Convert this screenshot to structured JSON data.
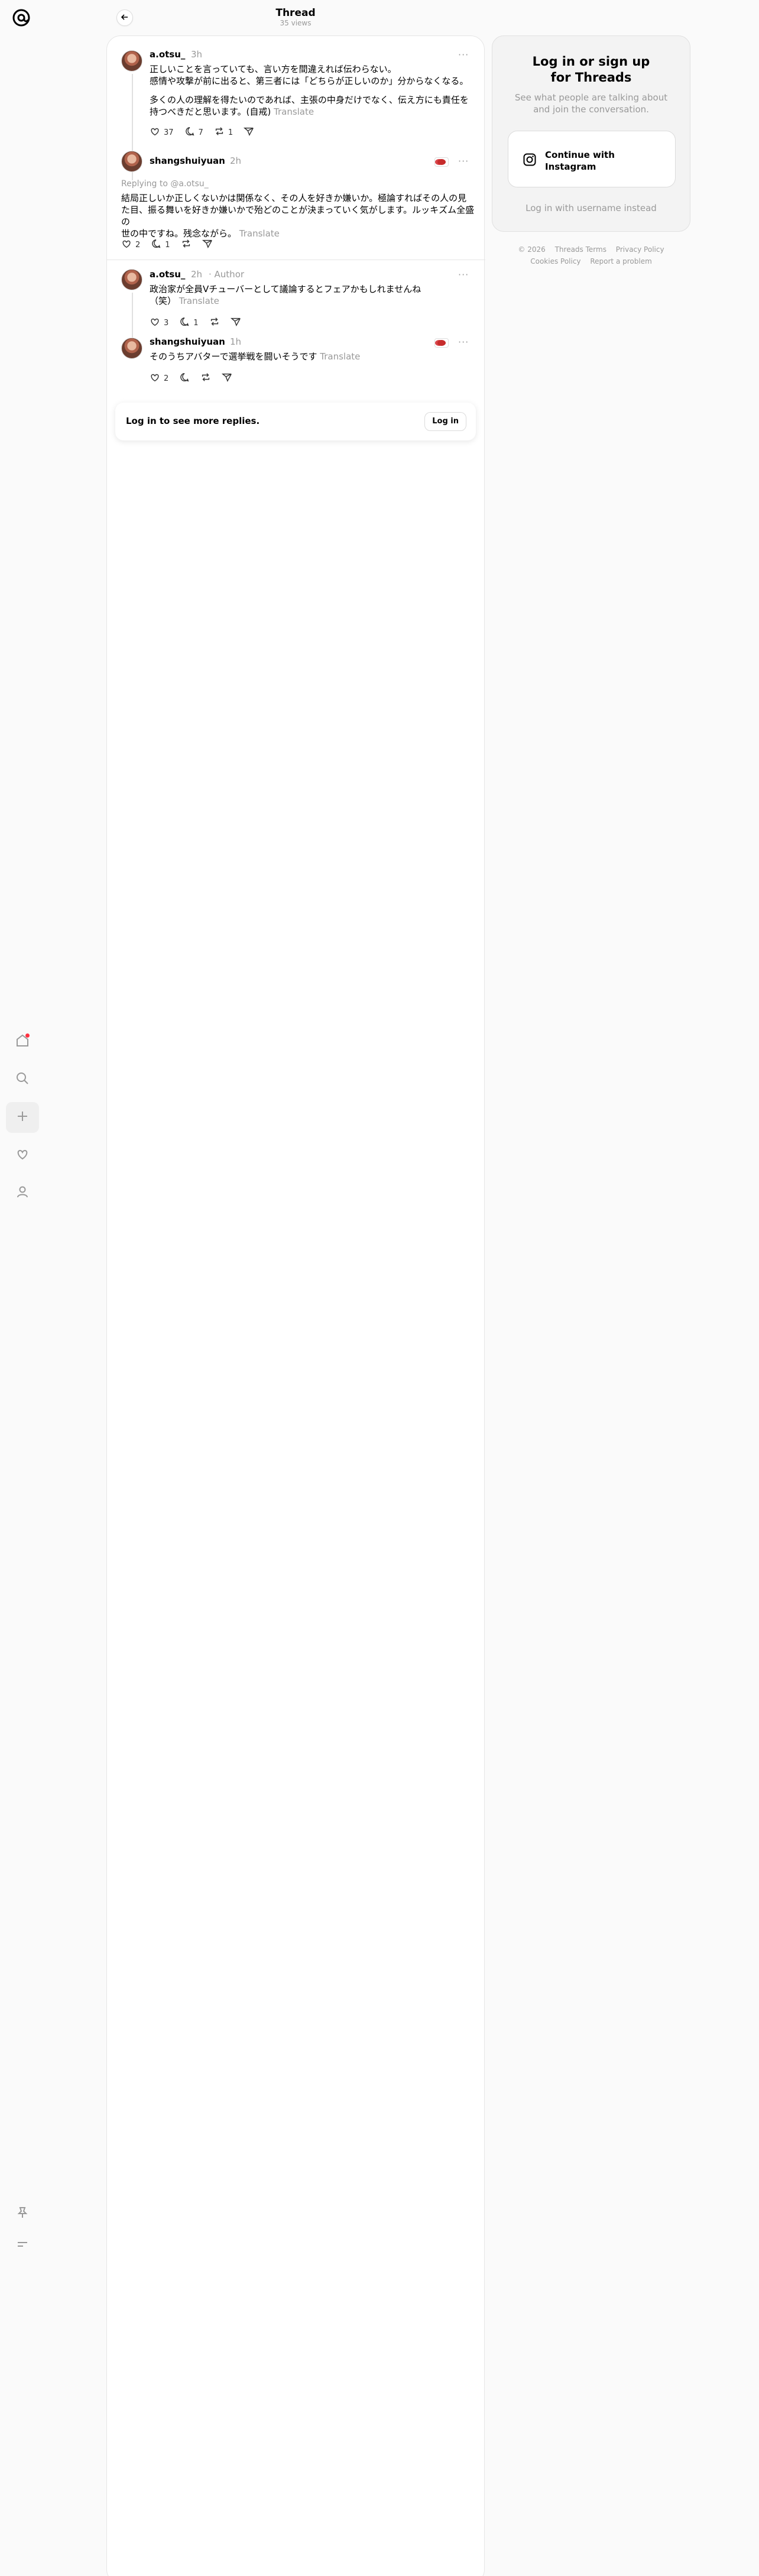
{
  "header": {
    "title": "Thread",
    "views": "35 views"
  },
  "posts": [
    {
      "username": "a.otsu_",
      "time": "3h",
      "lines": [
        "正しいことを言っていても、言い方を間違えれば伝わらない。",
        "感情や攻撃が前に出ると、第三者には「どちらが正しいのか」分からなくなる。",
        "多くの人の理解を得たいのであれば、主張の中身だけでなく、伝え方にも責任を",
        "持つべきだと思います。(自戒)"
      ],
      "translate": "Translate",
      "likes": "37",
      "replies": "7",
      "reposts": "1"
    },
    {
      "username": "shangshuiyuan",
      "time": "2h",
      "replying_to": "Replying to @a.otsu_",
      "lines": [
        "結局正しいか正しくないかは関係なく、その人を好きか嫌いか。極論すればその人の見",
        "た目、振る舞いを好きか嫌いかで殆どのことが決まっていく気がします。ルッキズム全盛の",
        "世の中ですね。残念ながら。"
      ],
      "translate": "Translate",
      "likes": "2",
      "replies": "1"
    },
    {
      "username": "a.otsu_",
      "time": "2h",
      "author": "· Author",
      "lines": [
        "政治家が全員Vチューバーとして議論するとフェアかもしれませんね",
        "（笑）"
      ],
      "translate": "Translate",
      "likes": "3",
      "replies": "1"
    },
    {
      "username": "shangshuiyuan",
      "time": "1h",
      "lines": [
        "そのうちアバターで選挙戦を闘いそうです"
      ],
      "translate": "Translate",
      "likes": "2"
    }
  ],
  "login_bar": {
    "label": "Log in to see more replies.",
    "button": "Log in"
  },
  "side": {
    "title_line1": "Log in or sign up",
    "title_line2": "for Threads",
    "sub_line1": "See what people are talking about",
    "sub_line2": "and join the conversation.",
    "ig_line1": "Continue with",
    "ig_line2": "Instagram",
    "alt": "Log in with username instead"
  },
  "footer": {
    "copyright": "© 2026",
    "terms": "Threads Terms",
    "privacy": "Privacy Policy",
    "cookies": "Cookies Policy",
    "report": "Report a problem"
  },
  "colors": {
    "notification_dot": "#ff3040",
    "muted_text": "#999999",
    "accent": "#000000"
  },
  "icons": [
    "threads-logo-icon",
    "home-icon",
    "search-icon",
    "plus-icon",
    "heart-icon",
    "profile-icon",
    "pin-icon",
    "menu-icon",
    "back-arrow-icon",
    "more-icon",
    "reply-icon",
    "repost-icon",
    "share-icon",
    "instagram-icon",
    "flag-icon"
  ]
}
